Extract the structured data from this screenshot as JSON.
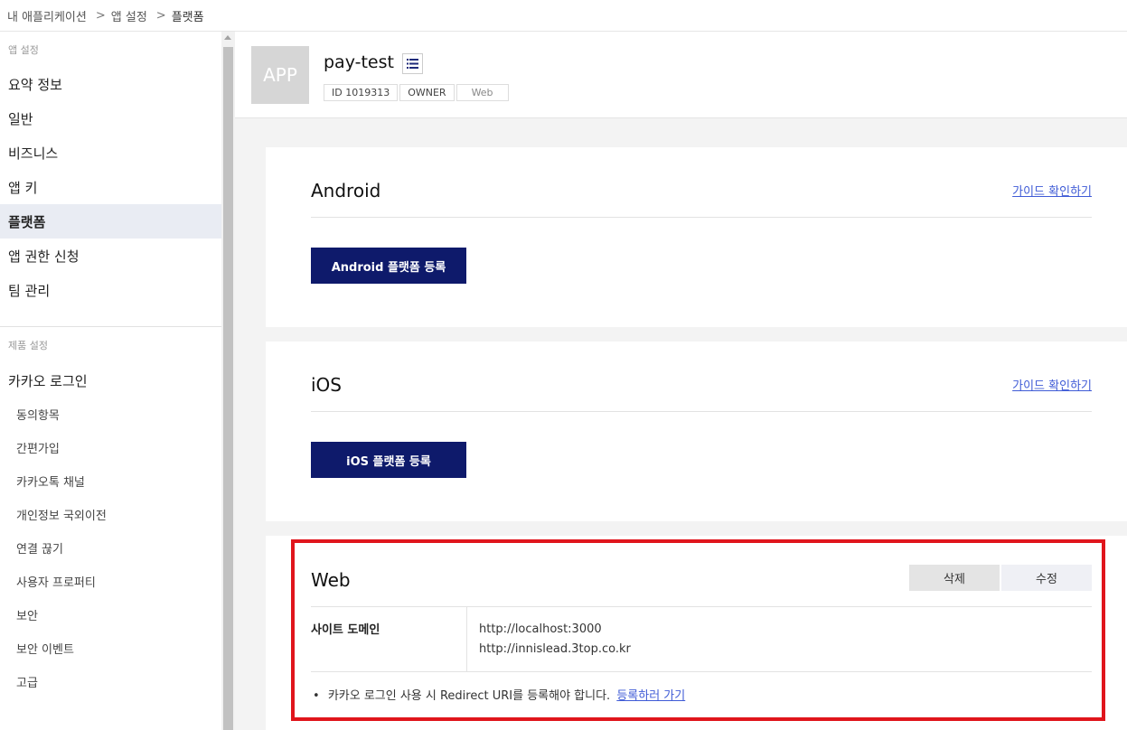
{
  "breadcrumb": {
    "item1": "내 애플리케이션",
    "sep": ">",
    "item2": "앱 설정",
    "item3": "플랫폼"
  },
  "sidebar": {
    "section_app": "앱 설정",
    "app_items": [
      {
        "label": "요약 정보"
      },
      {
        "label": "일반"
      },
      {
        "label": "비즈니스"
      },
      {
        "label": "앱 키"
      },
      {
        "label": "플랫폼",
        "active": true
      },
      {
        "label": "앱 권한 신청"
      },
      {
        "label": "팀 관리"
      }
    ],
    "section_product": "제품 설정",
    "product_main": "카카오 로그인",
    "product_subs": [
      {
        "label": "동의항목"
      },
      {
        "label": "간편가입"
      },
      {
        "label": "카카오톡 채널"
      },
      {
        "label": "개인정보 국외이전"
      },
      {
        "label": "연결 끊기"
      },
      {
        "label": "사용자 프로퍼티"
      },
      {
        "label": "보안"
      },
      {
        "label": "보안 이벤트"
      },
      {
        "label": "고급"
      }
    ]
  },
  "app": {
    "icon_text": "APP",
    "name": "pay-test",
    "tag_id": "ID 1019313",
    "tag_role": "OWNER",
    "tag_platform": "Web"
  },
  "android": {
    "title": "Android",
    "guide": "가이드 확인하기",
    "button": "Android 플랫폼 등록"
  },
  "ios": {
    "title": "iOS",
    "guide": "가이드 확인하기",
    "button": "iOS 플랫폼 등록"
  },
  "web": {
    "title": "Web",
    "delete_label": "삭제",
    "edit_label": "수정",
    "domain_label": "사이트 도메인",
    "domains": [
      "http://localhost:3000",
      "http://innislead.3top.co.kr"
    ],
    "note_bullet": "•",
    "note_text": "카카오 로그인 사용 시 Redirect URI를 등록해야 합니다.",
    "note_link": "등록하러 가기"
  },
  "colors": {
    "accent": "#0e1a6b",
    "link": "#3f5bd6",
    "highlight": "#e0151c",
    "active_bg": "#e9ecf3"
  }
}
